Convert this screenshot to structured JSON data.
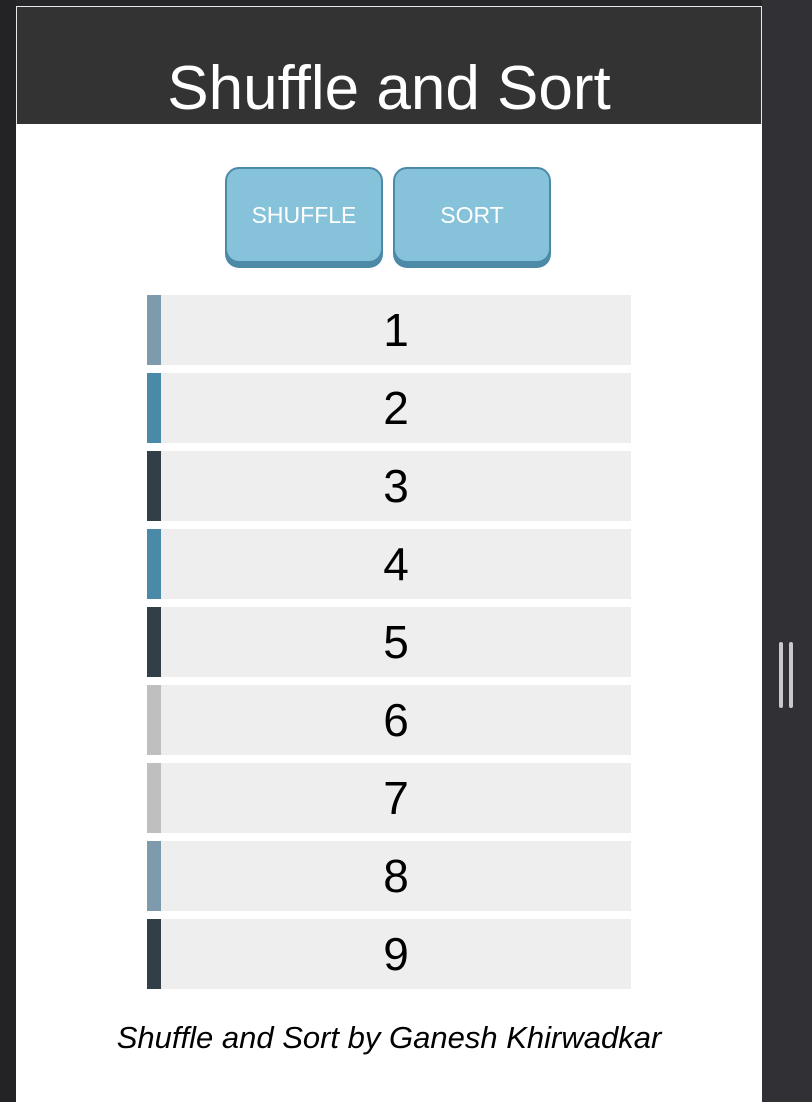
{
  "header": {
    "title": "Shuffle and Sort"
  },
  "controls": {
    "shuffle_label": "SHUFFLE",
    "sort_label": "SORT"
  },
  "list": {
    "items": [
      {
        "value": "1",
        "color": "#7e9aad"
      },
      {
        "value": "2",
        "color": "#4a8aa8"
      },
      {
        "value": "3",
        "color": "#333f47"
      },
      {
        "value": "4",
        "color": "#4a8aa8"
      },
      {
        "value": "5",
        "color": "#333f47"
      },
      {
        "value": "6",
        "color": "#bfbfbf"
      },
      {
        "value": "7",
        "color": "#bfbfbf"
      },
      {
        "value": "8",
        "color": "#7e9aad"
      },
      {
        "value": "9",
        "color": "#333f47"
      }
    ]
  },
  "footer": {
    "credit": "Shuffle and Sort by Ganesh Khirwadkar"
  },
  "colors": {
    "header_bg": "#333333",
    "button_bg": "#86c2da",
    "button_border": "#4d8aa7",
    "item_bg": "#eeeeee"
  }
}
